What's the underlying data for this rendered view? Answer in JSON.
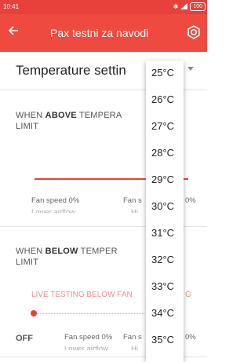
{
  "status": {
    "time": "10:41",
    "battery": "100"
  },
  "appbar": {
    "title": "Pax testni za navodi"
  },
  "selector": {
    "label": "Temperature settin"
  },
  "above": {
    "prefix": "WHEN ",
    "bold": "ABOVE",
    "suffix": " TEMPERA",
    "line2": "LIMIT",
    "fan_left": "Fan speed 0%",
    "fan_right": "Fan s",
    "fan_right_tail": "0%",
    "sub_left": "Lower airflow",
    "sub_right": "Hi"
  },
  "below": {
    "prefix": "WHEN ",
    "bold": "BELOW",
    "suffix": " TEMPER",
    "line2": "LIMIT",
    "live": "LIVE TESTING BELOW FAN",
    "live_tail": "G",
    "off": "OFF",
    "fan_left": "Fan speed 0%",
    "fan_right": "Fan s",
    "fan_right_tail": "0%",
    "sub_left": "Lower airflow",
    "sub_right": "Hi"
  },
  "dropdown": {
    "options": [
      "25°C",
      "26°C",
      "27°C",
      "28°C",
      "29°C",
      "30°C",
      "31°C",
      "32°C",
      "33°C",
      "34°C",
      "35°C"
    ]
  },
  "colors": {
    "primary": "#ef4a40",
    "statusbar": "#e8403a"
  },
  "icons": {
    "back": "arrow-left-icon",
    "settings": "gear-icon"
  }
}
